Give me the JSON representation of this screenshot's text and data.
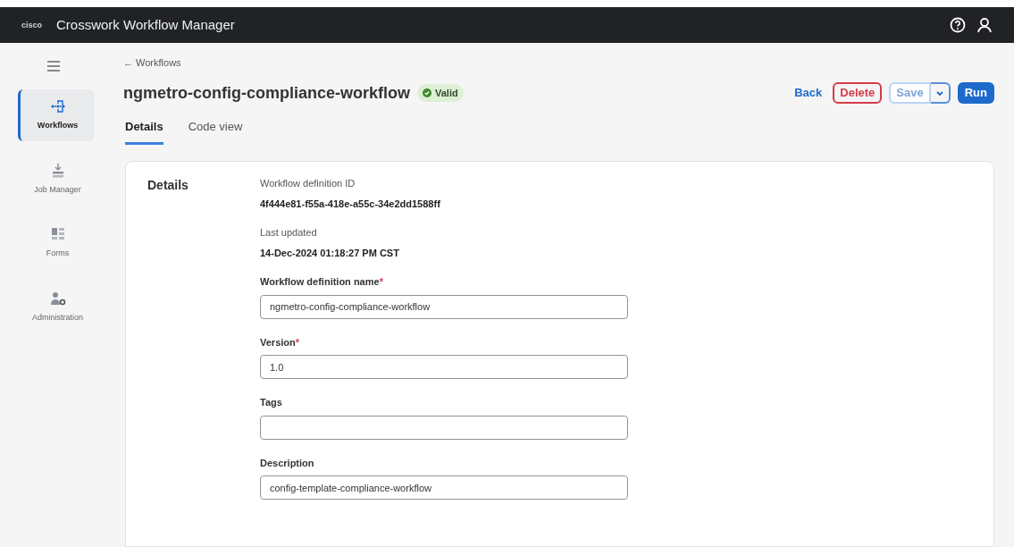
{
  "header": {
    "logo": "cisco",
    "title": "Crosswork Workflow Manager"
  },
  "sidebar": {
    "items": [
      {
        "label": "Workflows",
        "kind": "workflows",
        "selected": true
      },
      {
        "label": "Job Manager",
        "kind": "jobs",
        "selected": false
      },
      {
        "label": "Forms",
        "kind": "forms",
        "selected": false
      },
      {
        "label": "Administration",
        "kind": "admin",
        "selected": false
      }
    ]
  },
  "breadcrumb": "← Workflows",
  "page_title": "ngmetro-config-compliance-workflow",
  "status_badge": "Valid",
  "actions": [
    {
      "kind": "link",
      "label": "Back",
      "disabled": false
    },
    {
      "kind": "danger",
      "label": "Delete",
      "disabled": false
    },
    {
      "kind": "split",
      "label": "Save",
      "disabled": true
    },
    {
      "kind": "primary",
      "label": "Run",
      "disabled": false
    }
  ],
  "tabs": [
    {
      "label": "Details",
      "selected": true
    },
    {
      "label": "Code view",
      "selected": false
    }
  ],
  "details": {
    "heading": "Details",
    "info": [
      {
        "label": "Workflow definition ID",
        "value": "4f444e81-f55a-418e-a55c-34e2dd1588ff"
      },
      {
        "label": "Last updated",
        "value": "14-Dec-2024 01:18:27 PM CST"
      }
    ],
    "fields": [
      {
        "label": "Workflow definition name",
        "required_mark": "*",
        "value": "ngmetro-config-compliance-workflow"
      },
      {
        "label": "Version",
        "required_mark": "*",
        "value": "1.0"
      },
      {
        "label": "Tags"
      },
      {
        "label": "Description",
        "value": "config-template-compliance-workflow"
      }
    ]
  }
}
